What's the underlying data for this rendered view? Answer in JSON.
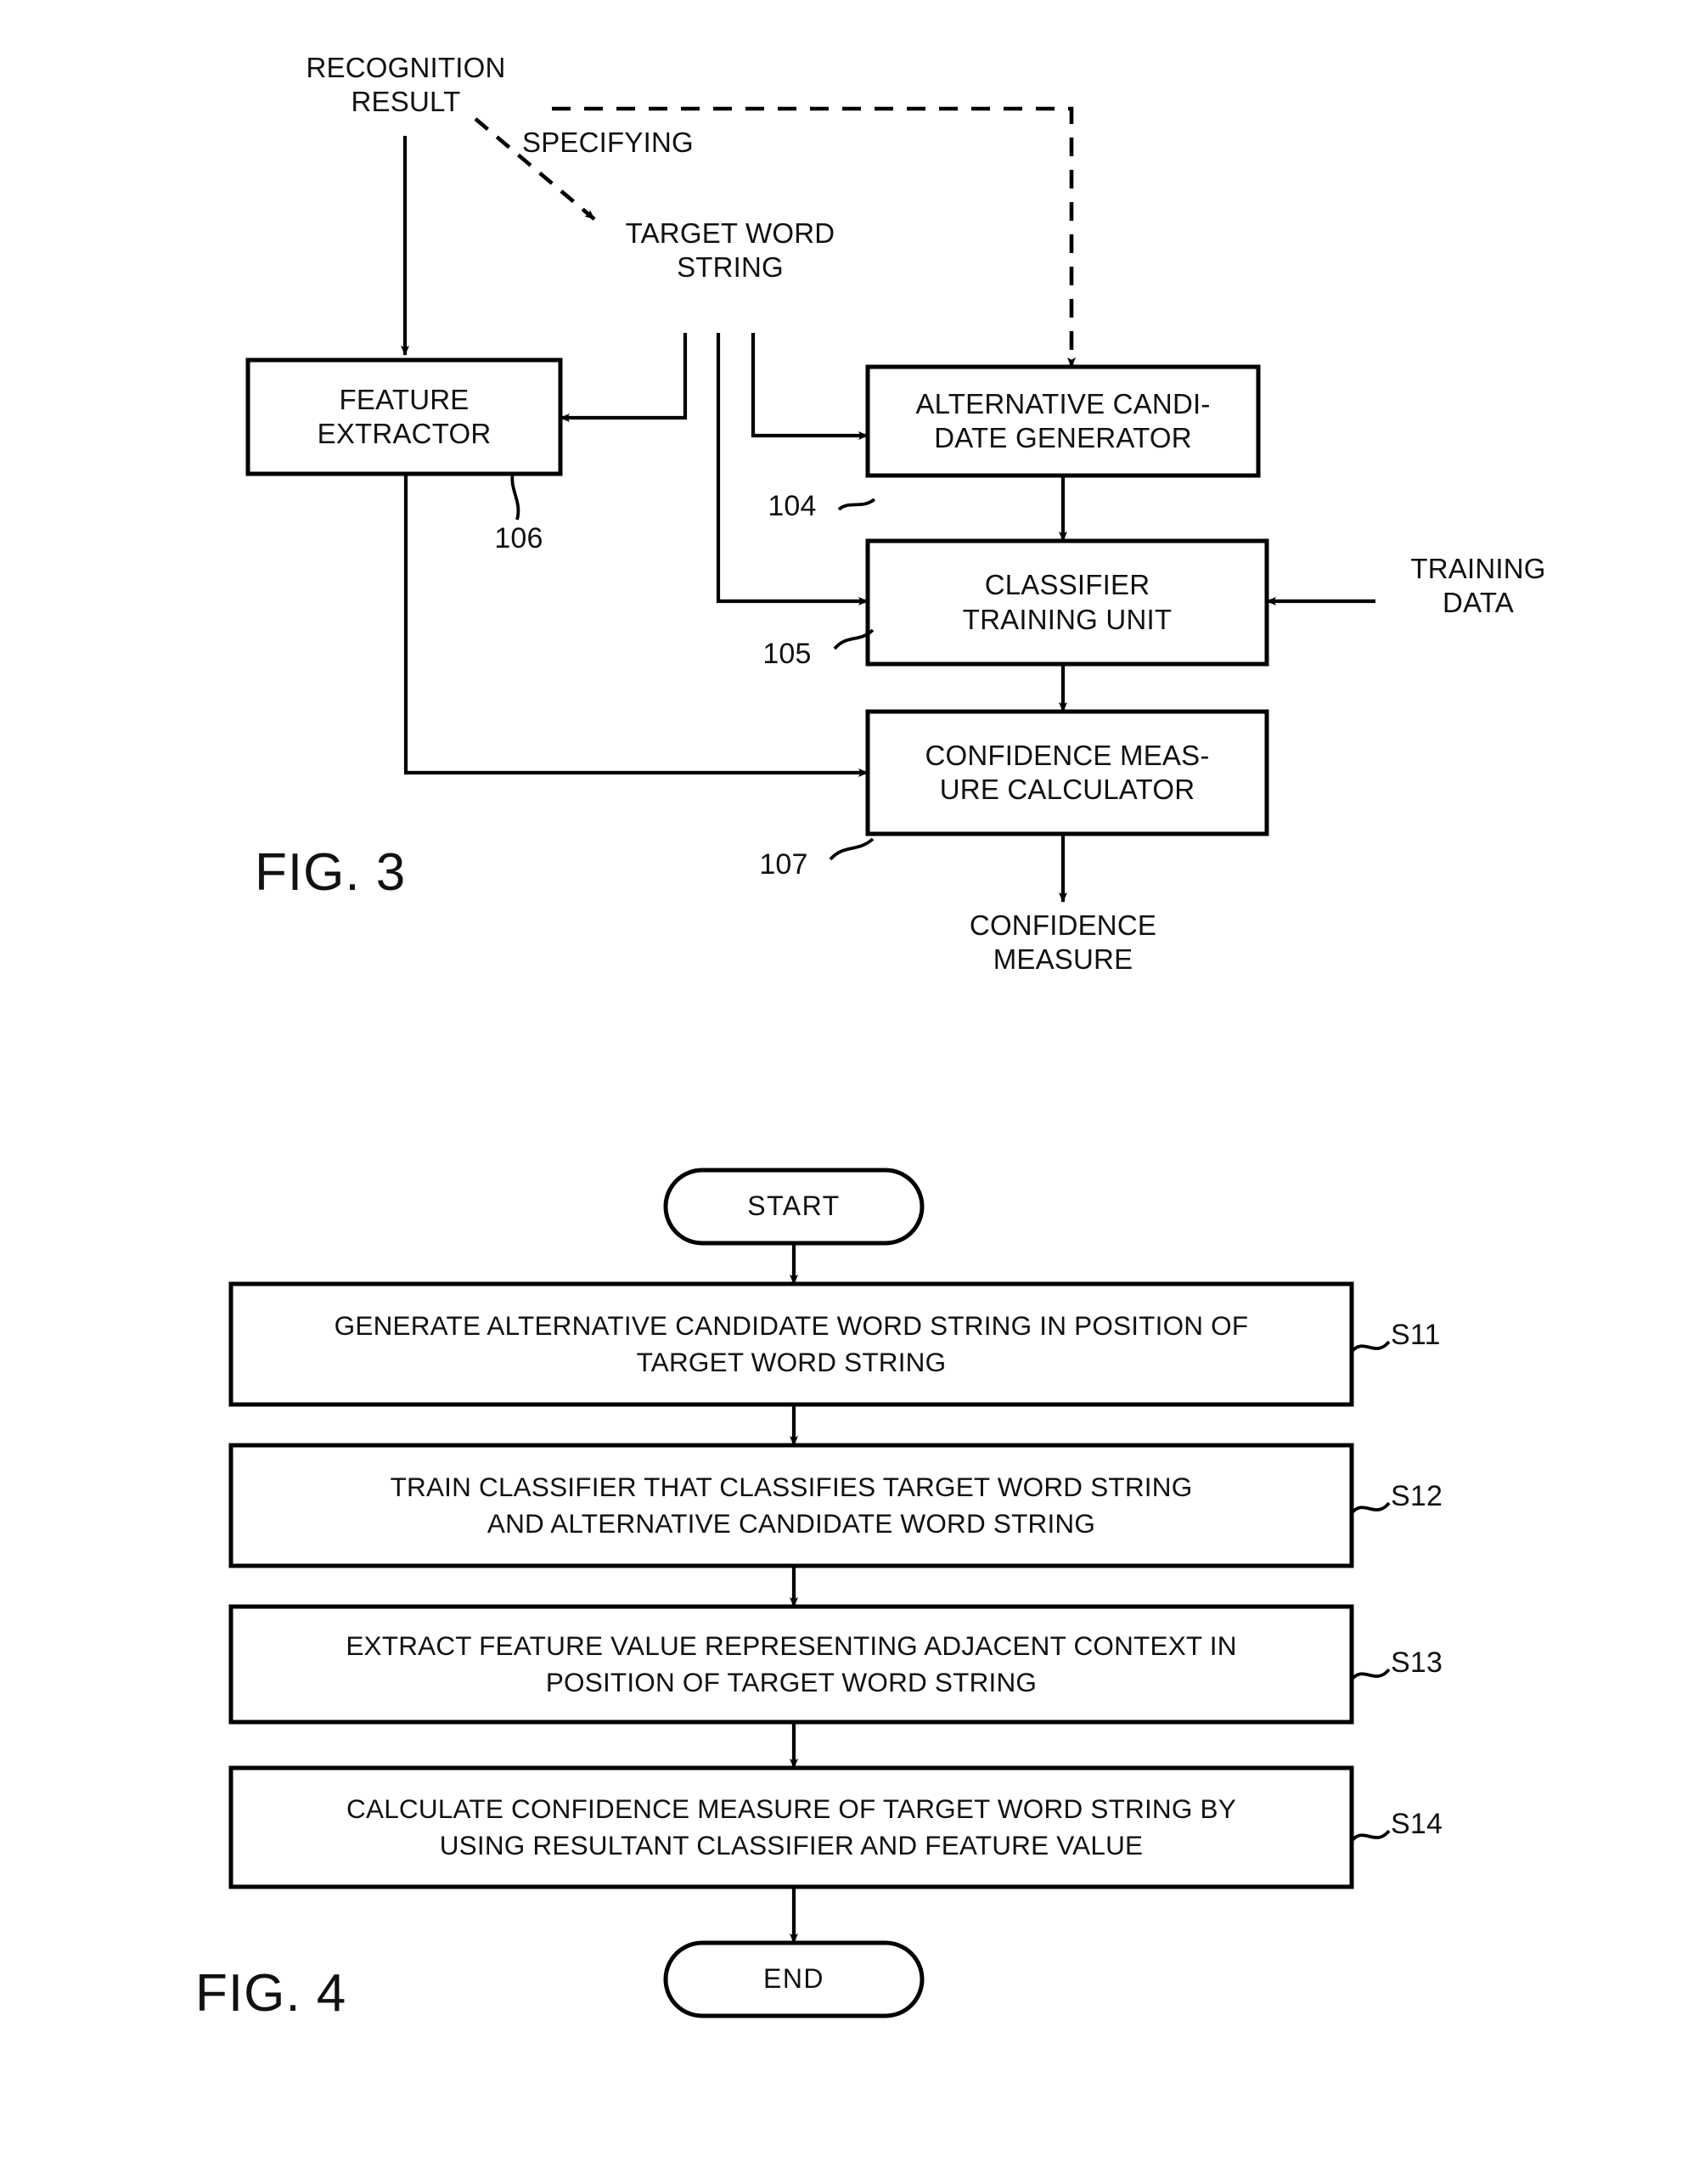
{
  "figures": [
    {
      "id": "fig3",
      "label": "FIG. 3",
      "kind": "block-diagram",
      "annotations": {
        "recognition_result": "RECOGNITION\nRESULT",
        "specifying": "SPECIFYING",
        "target_word_string": "TARGET WORD\nSTRING",
        "training_data": "TRAINING\nDATA",
        "confidence_measure_out": "CONFIDENCE\nMEASURE"
      },
      "blocks": [
        {
          "id": "feature_extractor",
          "label": "FEATURE\nEXTRACTOR",
          "ref": "106"
        },
        {
          "id": "alternative_candidate_generator",
          "label": "ALTERNATIVE CANDI-\nDATE GENERATOR",
          "ref": "104"
        },
        {
          "id": "classifier_training_unit",
          "label": "CLASSIFIER\nTRAINING UNIT",
          "ref": "105"
        },
        {
          "id": "confidence_measure_calculator",
          "label": "CONFIDENCE MEAS-\nURE CALCULATOR",
          "ref": "107"
        }
      ]
    },
    {
      "id": "fig4",
      "label": "FIG. 4",
      "kind": "flowchart",
      "terminators": {
        "start": "START",
        "end": "END"
      },
      "steps": [
        {
          "ref": "S11",
          "text": "GENERATE ALTERNATIVE CANDIDATE WORD STRING IN POSITION OF\nTARGET WORD STRING"
        },
        {
          "ref": "S12",
          "text": "TRAIN CLASSIFIER THAT CLASSIFIES TARGET WORD STRING\nAND ALTERNATIVE CANDIDATE WORD STRING"
        },
        {
          "ref": "S13",
          "text": "EXTRACT FEATURE VALUE REPRESENTING ADJACENT CONTEXT IN\nPOSITION OF TARGET WORD STRING"
        },
        {
          "ref": "S14",
          "text": "CALCULATE CONFIDENCE MEASURE OF TARGET WORD STRING BY\nUSING RESULTANT CLASSIFIER AND FEATURE VALUE"
        }
      ]
    }
  ],
  "colors": {
    "ink": "#000000",
    "paper": "#ffffff"
  }
}
